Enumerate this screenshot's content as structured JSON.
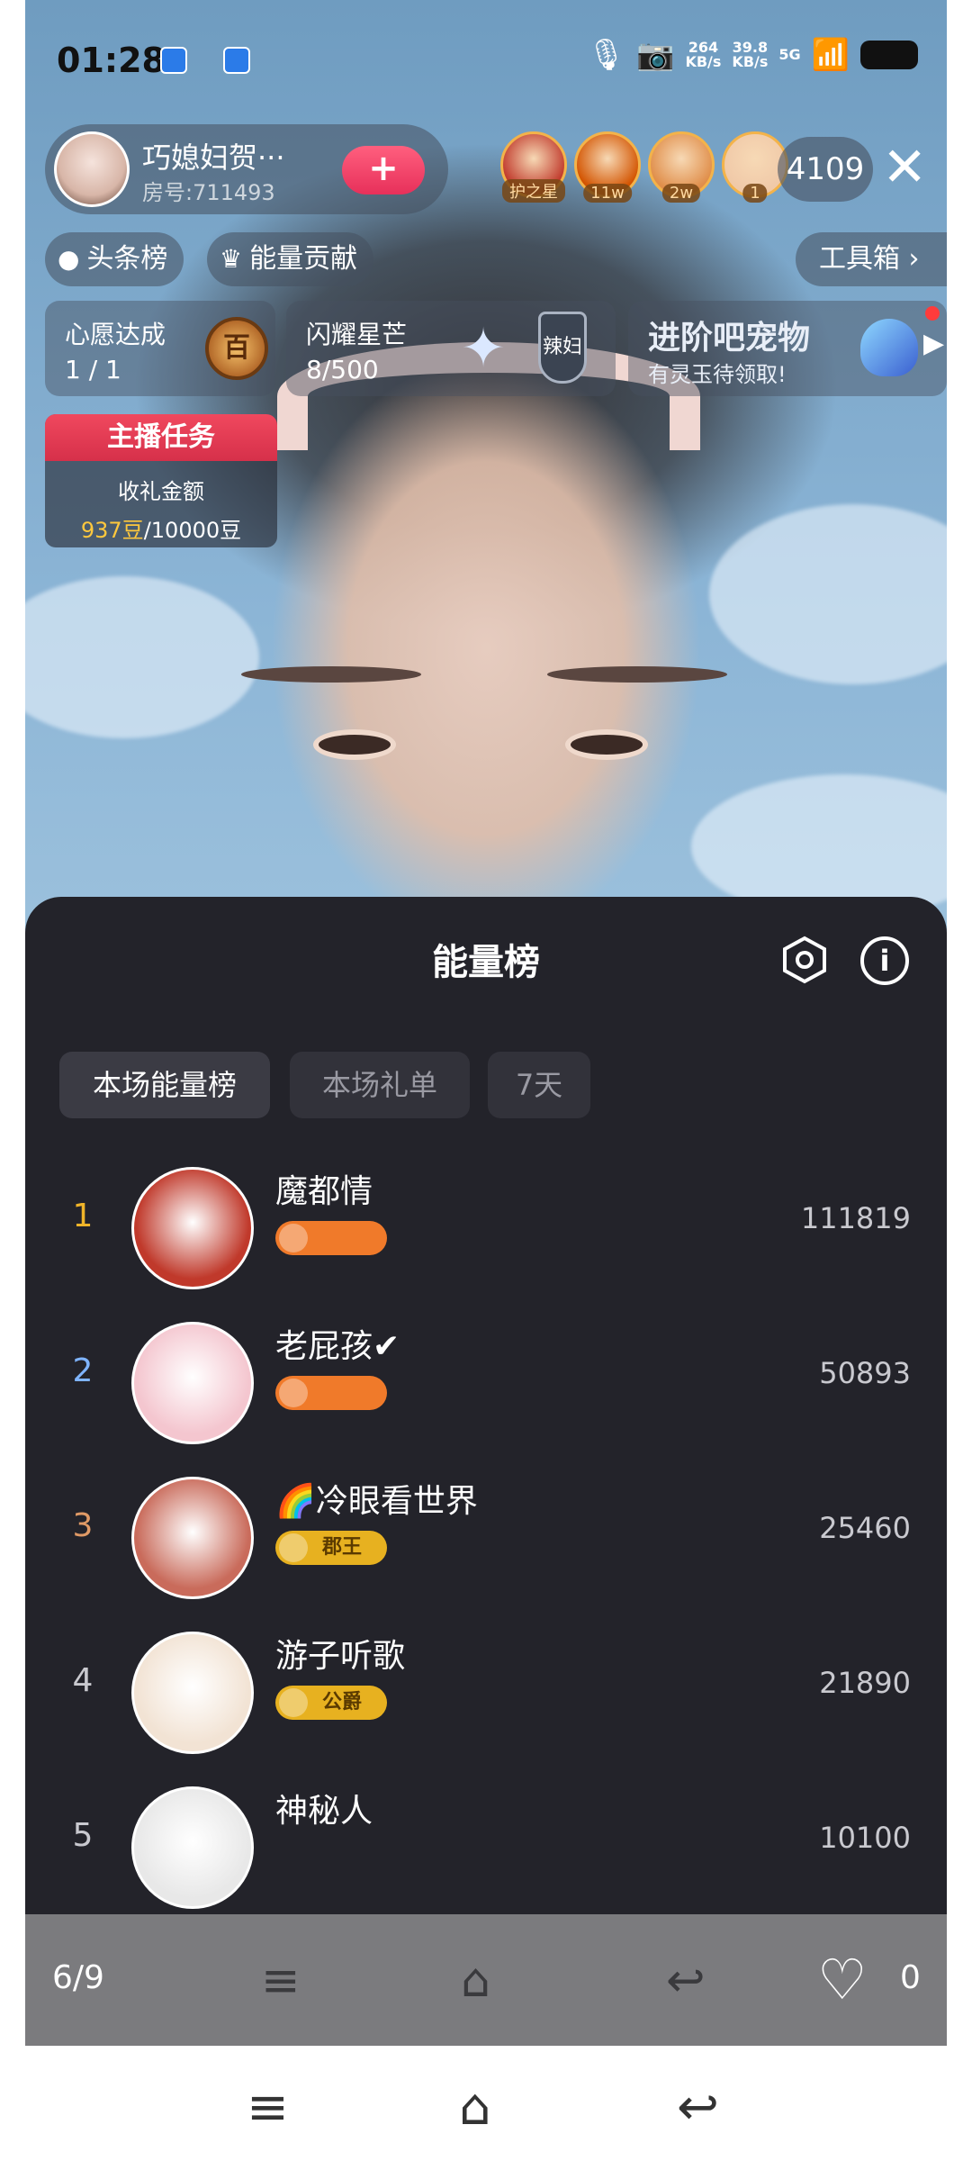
{
  "status_bar": {
    "time": "01:28",
    "net_speed_up": "264",
    "net_speed_up_unit": "KB/s",
    "net_speed_down": "39.8",
    "net_speed_down_unit": "KB/s",
    "network_type": "5G"
  },
  "anchor": {
    "name": "巧媳妇贺···",
    "room": "房号:711493",
    "follow_label": "+"
  },
  "viewers": {
    "avatars": [
      {
        "tag": "护之星",
        "color": "#c0392b"
      },
      {
        "tag": "11w",
        "color": "#d35400"
      },
      {
        "tag": "2w",
        "color": "#e08e4a"
      },
      {
        "tag": "1",
        "color": "#f0c9a8"
      }
    ],
    "count": "4109"
  },
  "chips": {
    "headlines": "头条榜",
    "energy_contrib": "能量贡献",
    "toolbox": "工具箱 ›"
  },
  "cards": {
    "wish": {
      "title": "心愿达成",
      "value": "1 / 1",
      "medal": "百"
    },
    "star": {
      "title": "闪耀星芒",
      "value": "8/500",
      "shield": "辣妇"
    },
    "pet": {
      "title": "进阶吧宠物",
      "subtitle": "有灵玉待领取!"
    }
  },
  "task": {
    "title": "主播任务",
    "subtitle": "收礼金额",
    "progress_current": "937豆",
    "progress_total": "/10000豆"
  },
  "panel": {
    "title": "能量榜",
    "tabs": [
      "本场能量榜",
      "本场礼单",
      "7天"
    ],
    "rows": [
      {
        "rank": "1",
        "name": "魔都情",
        "badge": "",
        "score": "111819",
        "rank_color": "#f0b429",
        "badge_color": "#f07a2a",
        "avatar_color": "#c0392b"
      },
      {
        "rank": "2",
        "name": "老屁孩✔",
        "badge": "",
        "score": "50893",
        "rank_color": "#7fb4ff",
        "badge_color": "#f07a2a",
        "avatar_color": "#f4c6cf"
      },
      {
        "rank": "3",
        "name": "🌈冷眼看世界",
        "badge": "郡王",
        "score": "25460",
        "rank_color": "#e09a66",
        "badge_color": "#e7b120",
        "avatar_color": "#c96b5b"
      },
      {
        "rank": "4",
        "name": "游子听歌",
        "badge": "公爵",
        "score": "21890",
        "rank_color": "#c9c9cf",
        "badge_color": "#e7b120",
        "avatar_color": "#f2e3d4"
      },
      {
        "rank": "5",
        "name": "神秘人",
        "badge": "",
        "score": "10100",
        "rank_color": "#c9c9cf",
        "badge_color": "",
        "avatar_color": "#e8e8e8"
      }
    ]
  },
  "viewer_nav": {
    "pager": "6/9",
    "likes": "0"
  }
}
